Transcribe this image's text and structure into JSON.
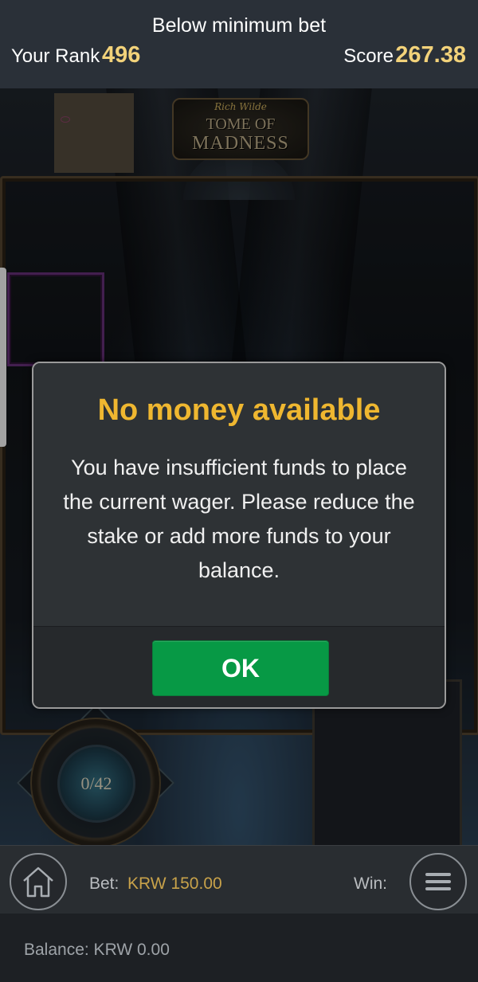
{
  "header": {
    "status_message": "Below minimum bet",
    "rank_label": "Your Rank",
    "rank_value": "496",
    "score_label": "Score",
    "score_value": "267.38"
  },
  "game": {
    "logo_small": "Rich Wilde",
    "logo_line1": "TOME OF",
    "logo_line2": "MADNESS",
    "counter": "0/42"
  },
  "dialog": {
    "title": "No money available",
    "message": "You have insufficient funds to place the current wager. Please reduce the stake or add more funds to your balance.",
    "ok_label": "OK"
  },
  "footer": {
    "bet_label": "Bet:",
    "bet_value": "KRW 150.00",
    "win_label": "Win:",
    "balance_text": "Balance: KRW 0.00"
  },
  "icons": {
    "home": "home-icon",
    "menu": "hamburger-menu-icon"
  },
  "colors": {
    "accent_gold": "#efb730",
    "score_yellow": "#f2d27a",
    "ok_green": "#079945",
    "bet_value": "#c8a24a"
  }
}
